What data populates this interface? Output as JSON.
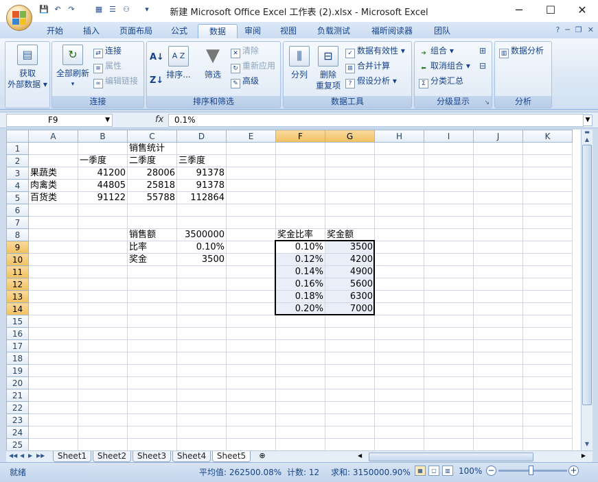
{
  "window": {
    "title": "新建 Microsoft Office Excel 工作表 (2).xlsx - Microsoft Excel",
    "minimize": "─",
    "maximize": "☐",
    "close": "✕"
  },
  "qat": {
    "save": "💾",
    "undo": "↶",
    "redo": "↷",
    "icon4": "▦",
    "icon5": "☰",
    "icon6": "⚇",
    "more": "▾"
  },
  "tabs": [
    "开始",
    "插入",
    "页面布局",
    "公式",
    "数据",
    "审阅",
    "视图",
    "负载测试",
    "福昕阅读器",
    "团队"
  ],
  "active_tab": "数据",
  "mdi": {
    "help": "?",
    "min": "─",
    "restore": "❐",
    "close": "✕"
  },
  "ribbon": {
    "get_external": "获取\n外部数据",
    "get_external_1": "获取",
    "get_external_2": "外部数据 ▾",
    "refresh_all_1": "全部刷新",
    "refresh_all_2": "▾",
    "connections": "连接",
    "properties": "属性",
    "edit_links": "编辑链接",
    "group_connections": "连接",
    "sort_label": "排序...",
    "filter_label": "筛选",
    "clear": "清除",
    "reapply": "重新应用",
    "advanced": "高级",
    "group_sort_filter": "排序和筛选",
    "text_to_columns": "分列",
    "remove_dup_1": "删除",
    "remove_dup_2": "重复项",
    "data_validation": "数据有效性 ▾",
    "consolidate": "合并计算",
    "what_if": "假设分析 ▾",
    "group_data_tools": "数据工具",
    "group": "组合 ▾",
    "ungroup": "取消组合 ▾",
    "subtotal": "分类汇总",
    "group_outline": "分级显示",
    "data_analysis": "数据分析",
    "group_analysis": "分析"
  },
  "formula_bar": {
    "name_box": "F9",
    "fx": "fx",
    "value": "0.1%"
  },
  "columns": [
    "A",
    "B",
    "C",
    "D",
    "E",
    "F",
    "G",
    "H",
    "I",
    "J",
    "K"
  ],
  "selected_columns": [
    "F",
    "G"
  ],
  "selected_rows": [
    9,
    10,
    11,
    12,
    13,
    14
  ],
  "rows": [
    {
      "n": "1",
      "cells": {
        "C": "销售统计"
      }
    },
    {
      "n": "2",
      "cells": {
        "B": "一季度",
        "C": "二季度",
        "D": "三季度"
      }
    },
    {
      "n": "3",
      "cells": {
        "A": "果蔬类",
        "B": "41200",
        "C": "28006",
        "D": "91378"
      }
    },
    {
      "n": "4",
      "cells": {
        "A": "肉禽类",
        "B": "44805",
        "C": "25818",
        "D": "91378"
      }
    },
    {
      "n": "5",
      "cells": {
        "A": "百货类",
        "B": "91122",
        "C": "55788",
        "D": "112864"
      }
    },
    {
      "n": "6",
      "cells": {}
    },
    {
      "n": "7",
      "cells": {}
    },
    {
      "n": "8",
      "cells": {
        "C": "销售额",
        "D": "3500000",
        "F": "奖金比率",
        "G": "奖金额"
      }
    },
    {
      "n": "9",
      "cells": {
        "C": "比率",
        "D": "0.10%",
        "F": "0.10%",
        "G": "3500"
      }
    },
    {
      "n": "10",
      "cells": {
        "C": "奖金",
        "D": "3500",
        "F": "0.12%",
        "G": "4200"
      }
    },
    {
      "n": "11",
      "cells": {
        "F": "0.14%",
        "G": "4900"
      }
    },
    {
      "n": "12",
      "cells": {
        "F": "0.16%",
        "G": "5600"
      }
    },
    {
      "n": "13",
      "cells": {
        "F": "0.18%",
        "G": "6300"
      }
    },
    {
      "n": "14",
      "cells": {
        "F": "0.20%",
        "G": "7000"
      }
    },
    {
      "n": "15",
      "cells": {}
    },
    {
      "n": "16",
      "cells": {}
    },
    {
      "n": "17",
      "cells": {}
    },
    {
      "n": "18",
      "cells": {}
    },
    {
      "n": "19",
      "cells": {}
    },
    {
      "n": "20",
      "cells": {}
    },
    {
      "n": "21",
      "cells": {}
    },
    {
      "n": "22",
      "cells": {}
    },
    {
      "n": "23",
      "cells": {}
    },
    {
      "n": "24",
      "cells": {}
    },
    {
      "n": "25",
      "cells": {}
    }
  ],
  "sheet_tabs": [
    "Sheet1",
    "Sheet2",
    "Sheet3",
    "Sheet4",
    "Sheet5"
  ],
  "active_sheet": "Sheet5",
  "sheet_nav": [
    "◀◀",
    "◀",
    "▶",
    "▶▶"
  ],
  "status": {
    "ready": "就绪",
    "average": "平均值: 262500.08%",
    "count": "计数: 12",
    "sum": "求和: 3150000.90%",
    "zoom": "100%",
    "zoom_out": "−",
    "zoom_in": "+"
  }
}
